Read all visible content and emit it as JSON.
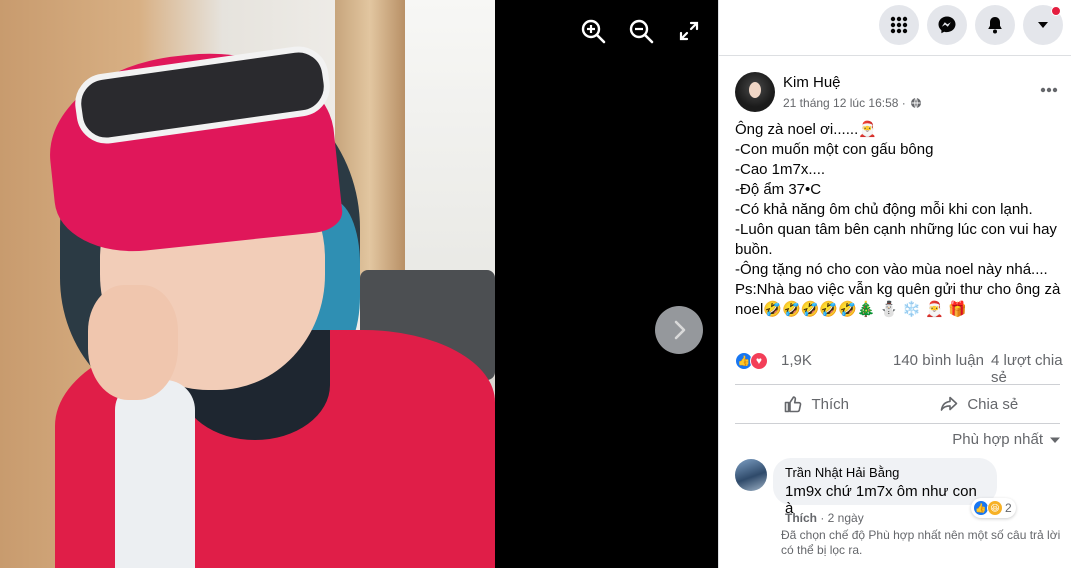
{
  "viewer": {
    "zoom_in": "zoom-in",
    "zoom_out": "zoom-out",
    "fullscreen": "fullscreen",
    "next": "next"
  },
  "topnav": {
    "icons": [
      "grid-menu-icon",
      "messenger-icon",
      "bell-icon",
      "caret-down-icon"
    ],
    "notification_dot_color": "#e41e3f"
  },
  "post": {
    "author": "Kim Huệ",
    "timestamp": "21 tháng 12 lúc 16:58 ·",
    "privacy_icon": "globe-icon",
    "lines": [
      "Ông zà noel ơi......🎅",
      "-Con muốn một con gấu bông",
      "-Cao 1m7x....",
      "-Độ ẩm 37•C",
      "-Có khả năng ôm chủ động mỗi khi con lạnh.",
      "-Luôn quan tâm bên cạnh những lúc con vui hay buồn.",
      "-Ông tặng nó cho con vào mùa noel này nhá....",
      "Ps:Nhà bao việc vẫn kg quên gửi thư cho ông zà noel🤣🤣🤣🤣🤣🎄 ⛄ ❄️ 🎅 🎁"
    ],
    "reactions_count": "1,9K",
    "comments_count": "140 bình luận",
    "shares_count": "4 lượt chia sẻ",
    "like_label": "Thích",
    "share_label": "Chia sẻ",
    "sort_label": "Phù hợp nhất"
  },
  "comment": {
    "name": "Trần Nhật Hải Bằng",
    "text": "1m9x chứ 1m7x ôm như con à",
    "reaction_count": "2",
    "like_label": "Thích",
    "time": "· 2 ngày"
  },
  "note": "Đã chọn chế độ Phù hợp nhất nên một số câu trả lời có thể bị lọc ra.",
  "colors": {
    "accent": "#1877f2",
    "love": "#f33e58",
    "haha": "#f7b125"
  }
}
